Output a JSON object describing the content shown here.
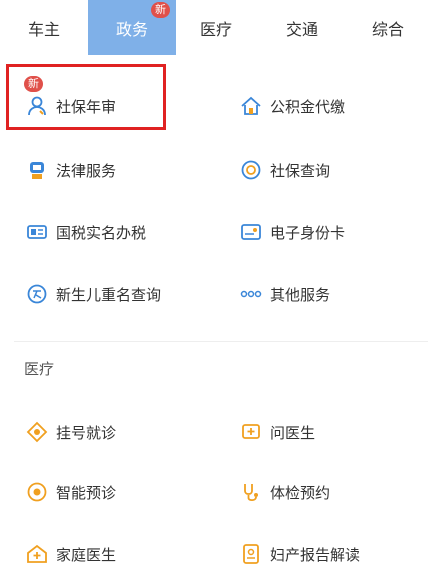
{
  "tabs": [
    {
      "label": "车主"
    },
    {
      "label": "政务",
      "badge": "新",
      "active": true
    },
    {
      "label": "医疗"
    },
    {
      "label": "交通"
    },
    {
      "label": "综合"
    }
  ],
  "gov_services": [
    {
      "label": "社保年审",
      "icon": "person-icon",
      "badge": "新",
      "highlighted": true
    },
    {
      "label": "公积金代缴",
      "icon": "house-icon"
    },
    {
      "label": "法律服务",
      "icon": "judge-icon"
    },
    {
      "label": "社保查询",
      "icon": "social-security-icon"
    },
    {
      "label": "国税实名办税",
      "icon": "id-card-icon"
    },
    {
      "label": "电子身份卡",
      "icon": "e-card-icon"
    },
    {
      "label": "新生儿重名查询",
      "icon": "name-icon"
    },
    {
      "label": "其他服务",
      "icon": "more-dots-icon"
    }
  ],
  "medical_section": {
    "title": "医疗",
    "items": [
      {
        "label": "挂号就诊",
        "icon": "register-icon"
      },
      {
        "label": "问医生",
        "icon": "chat-doctor-icon"
      },
      {
        "label": "智能预诊",
        "icon": "smart-diagnosis-icon"
      },
      {
        "label": "体检预约",
        "icon": "stethoscope-icon"
      },
      {
        "label": "家庭医生",
        "icon": "family-doctor-icon"
      },
      {
        "label": "妇产报告解读",
        "icon": "report-icon"
      }
    ]
  },
  "colors": {
    "active_tab": "#7fb0e8",
    "badge": "#e0504a",
    "highlight_border": "#e02222",
    "blue_icon": "#3a86d8",
    "orange_icon": "#f0a020"
  }
}
